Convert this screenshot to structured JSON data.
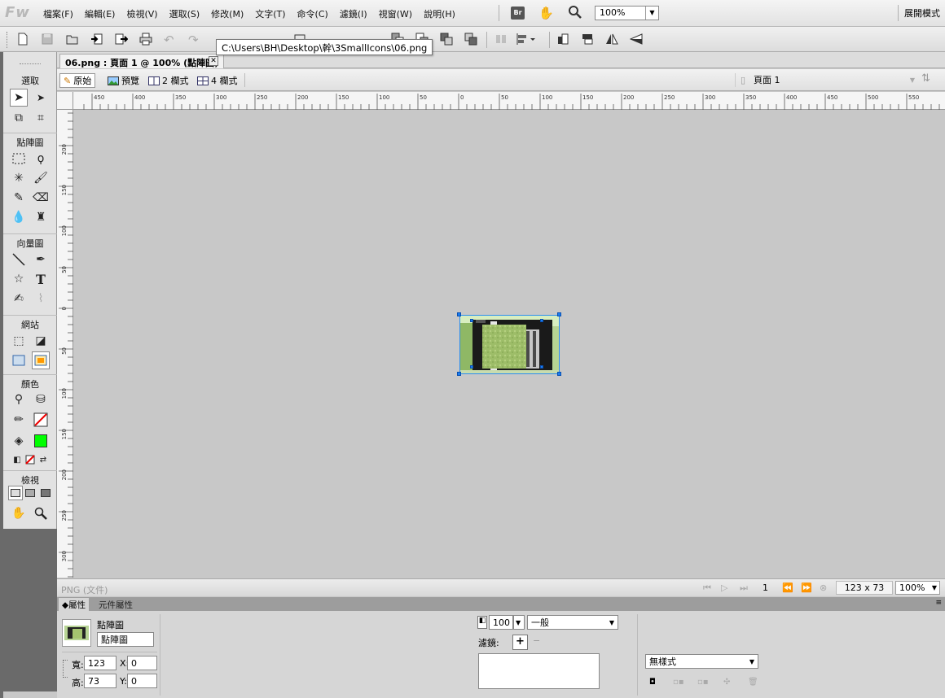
{
  "app": {
    "logo": "Fw"
  },
  "menu": [
    "檔案(F)",
    "編輯(E)",
    "檢視(V)",
    "選取(S)",
    "修改(M)",
    "文字(T)",
    "命令(C)",
    "濾鏡(I)",
    "視窗(W)",
    "說明(H)"
  ],
  "menubar": {
    "bridge_label": "Br",
    "zoom": "100%",
    "workspace": "展開模式"
  },
  "tooltip": "C:\\Users\\BH\\Desktop\\幹\\3SmallIcons\\06.png",
  "document": {
    "tab_title": "06.png : 頁面 1 @ 100% (點陣圖)"
  },
  "viewbar": {
    "original": "原始",
    "preview": "預覽",
    "two_up": "2 欄式",
    "four_up": "4 欄式",
    "page": "頁面 1"
  },
  "tools": {
    "select": "選取",
    "bitmap": "點陣圖",
    "vector": "向量圖",
    "web": "網站",
    "colors": "顏色",
    "view": "檢視",
    "fill_color": "#00ff00",
    "stroke_color": "#ffffff"
  },
  "rulers": {
    "h_labels": [
      "450",
      "400",
      "350",
      "300",
      "250",
      "200",
      "150",
      "100",
      "50",
      "0",
      "50",
      "100",
      "150",
      "200",
      "250",
      "300",
      "350",
      "400",
      "450",
      "500",
      "550"
    ],
    "v_labels": [
      "200",
      "150",
      "100",
      "50",
      "0",
      "50",
      "100",
      "150",
      "200",
      "250",
      "300"
    ]
  },
  "statusbar": {
    "doc_type": "PNG (文件)",
    "frame": "1",
    "size": "123 x 73",
    "zoom": "100%"
  },
  "properties": {
    "tab_props": "屬性",
    "tab_symbol": "元件屬性",
    "type": "點陣圖",
    "name": "點陣圖",
    "width_label": "寬:",
    "width": "123",
    "height_label": "高:",
    "height": "73",
    "x_label": "X:",
    "x": "0",
    "y_label": "Y:",
    "y": "0",
    "opacity": "100",
    "blend": "一般",
    "filters_label": "濾鏡:",
    "style": "無樣式"
  }
}
